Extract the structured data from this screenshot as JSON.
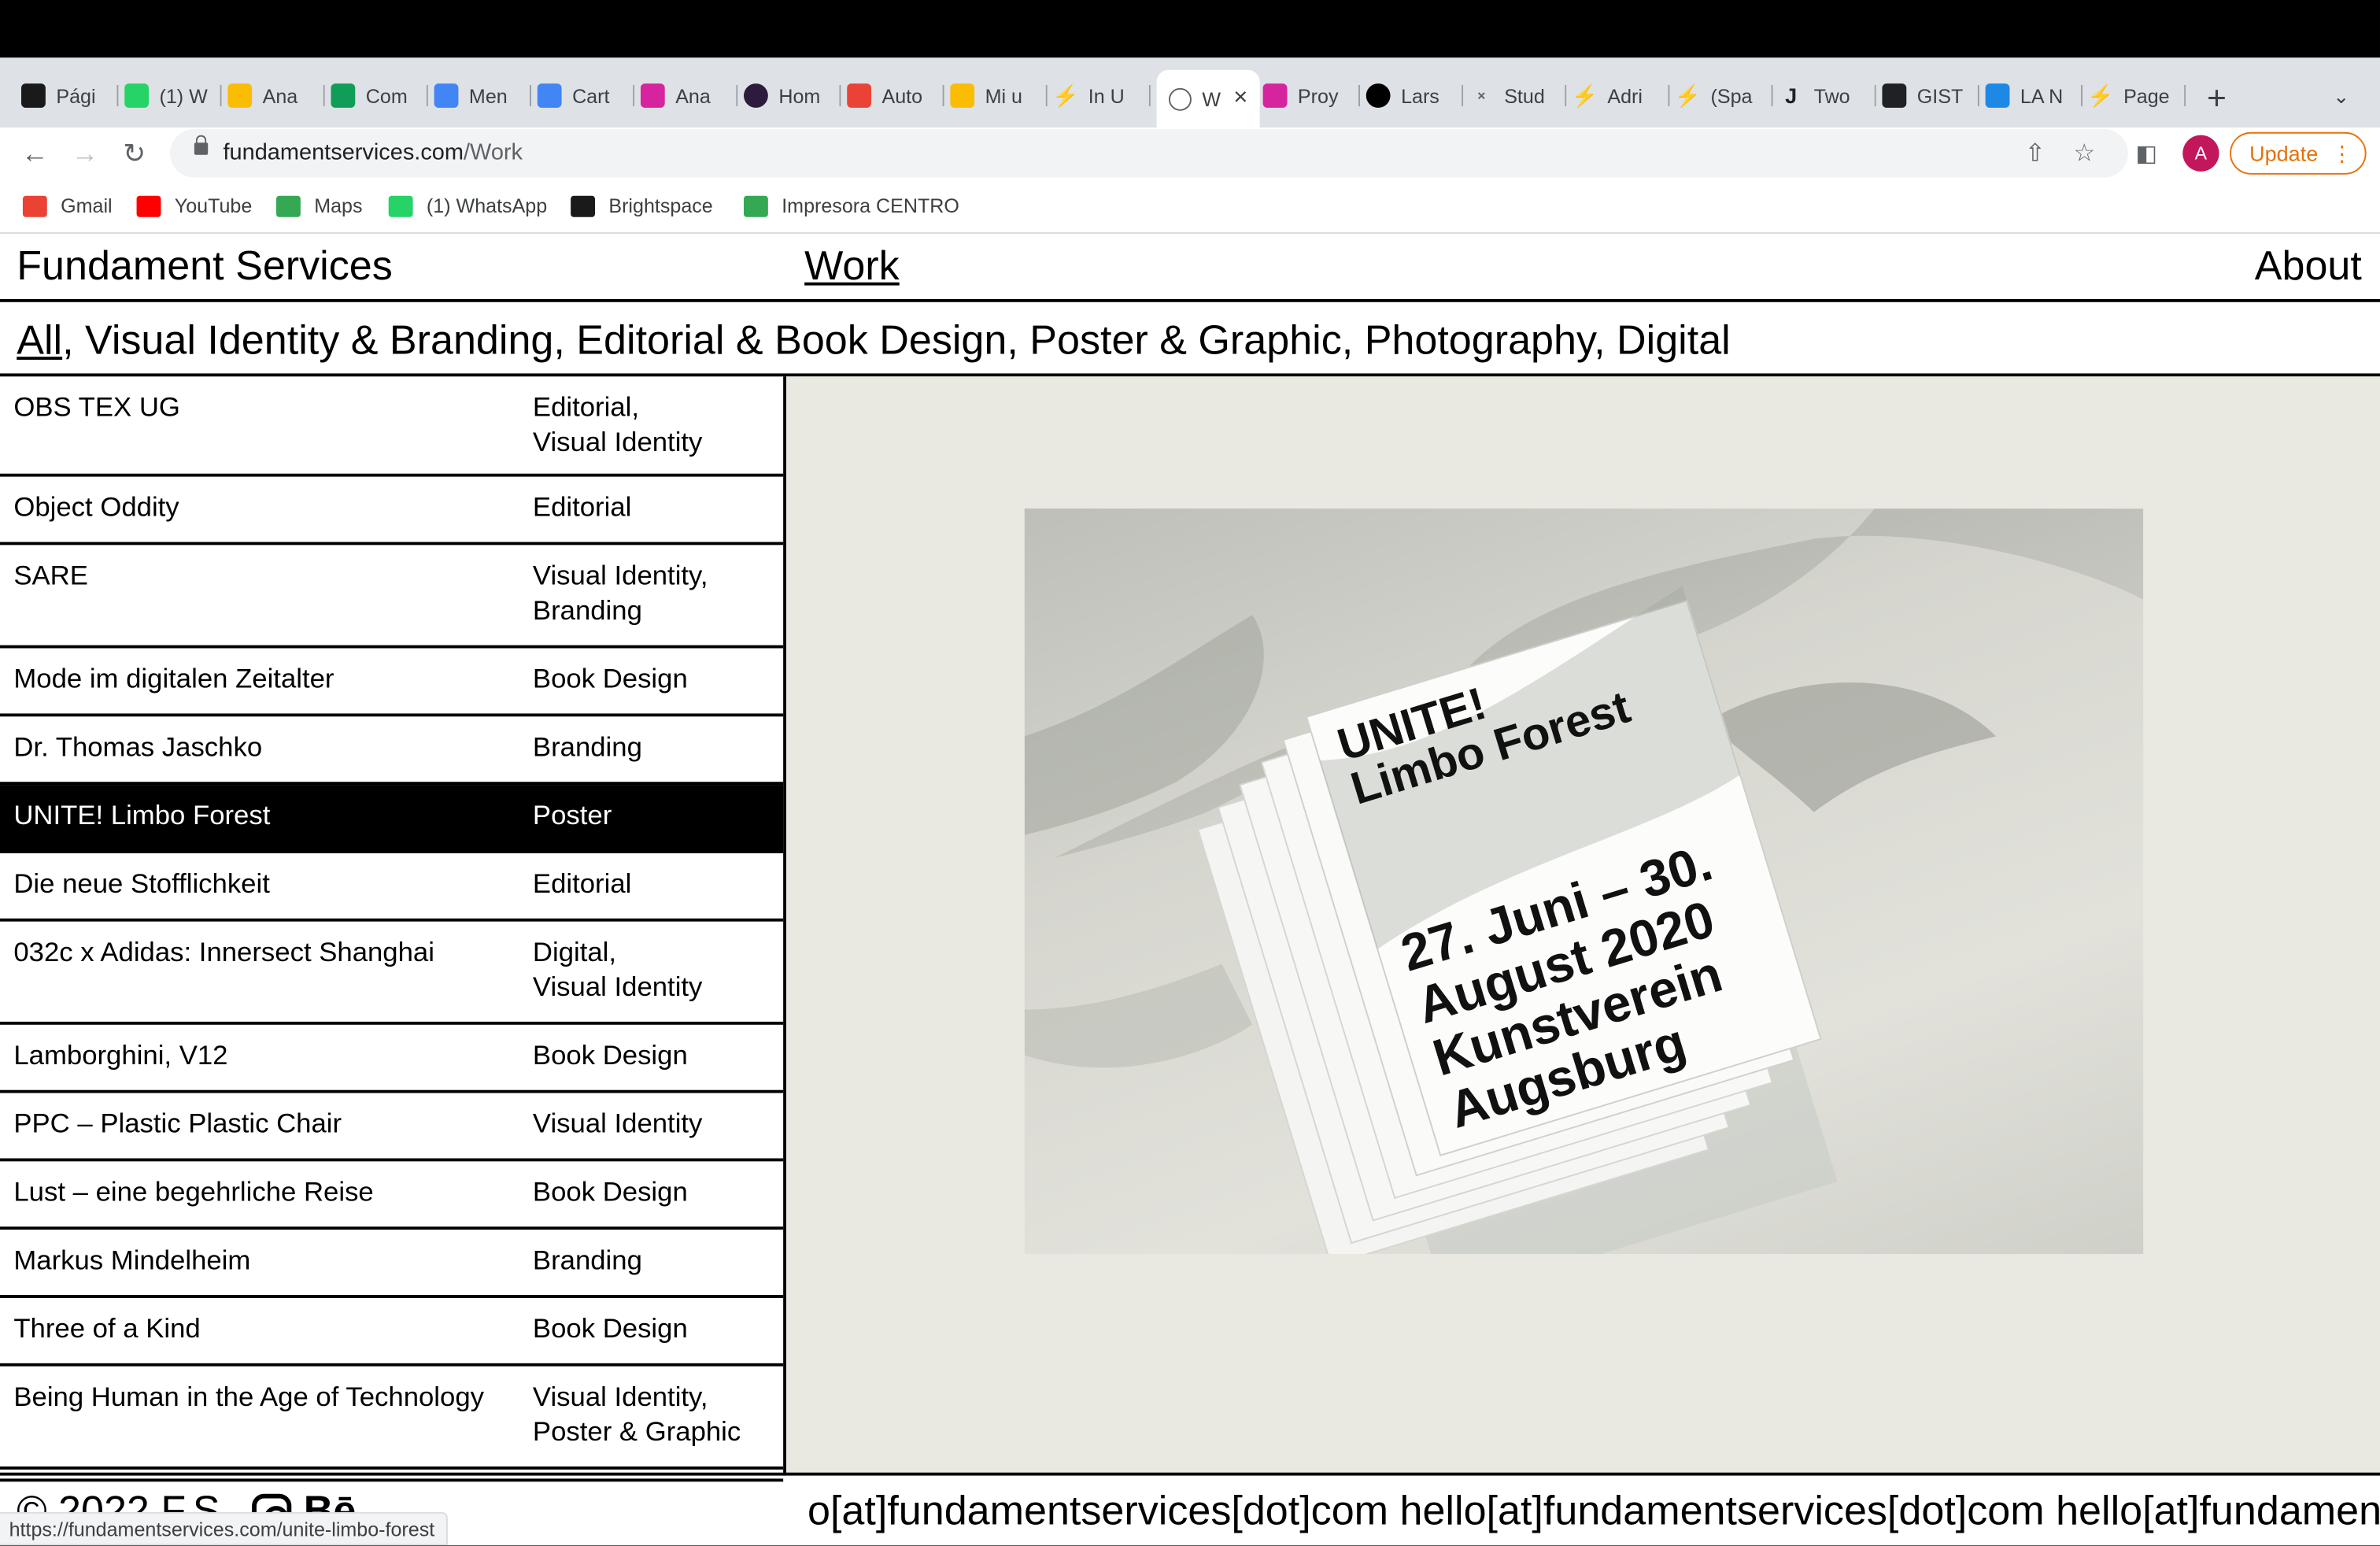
{
  "browser": {
    "tabs": [
      {
        "label": "Pági",
        "icon": "d2l-icon",
        "color": "#1a1a1a"
      },
      {
        "label": "(1) W",
        "icon": "whatsapp-icon",
        "color": "#25d366"
      },
      {
        "label": "Ana",
        "icon": "drive-icon",
        "color": "#fbbc04"
      },
      {
        "label": "Com",
        "icon": "sheets-icon",
        "color": "#0f9d58"
      },
      {
        "label": "Men",
        "icon": "docs-icon",
        "color": "#4285f4"
      },
      {
        "label": "Cart",
        "icon": "docs-icon",
        "color": "#4285f4"
      },
      {
        "label": "Ana",
        "icon": "instagram-icon",
        "color": "#d6249f"
      },
      {
        "label": "Hom",
        "icon": "circle-icon",
        "color": "#2d1b3d"
      },
      {
        "label": "Auto",
        "icon": "gmail-icon",
        "color": "#ea4335"
      },
      {
        "label": "Mi u",
        "icon": "drive-icon",
        "color": "#fbbc04"
      },
      {
        "label": "In U",
        "icon": "bolt-icon",
        "color": "#202124"
      },
      {
        "label": "W",
        "icon": "smiley-icon",
        "color": "#5f6368",
        "active": true
      },
      {
        "label": "Proy",
        "icon": "instagram-icon",
        "color": "#d6249f"
      },
      {
        "label": "Lars",
        "icon": "circle-icon",
        "color": "#000000"
      },
      {
        "label": "Stud",
        "icon": "x-icon",
        "color": "#5f6368"
      },
      {
        "label": "Adri",
        "icon": "bolt-icon",
        "color": "#202124"
      },
      {
        "label": "(Spa",
        "icon": "bolt-icon",
        "color": "#202124"
      },
      {
        "label": "Two",
        "icon": "j-icon",
        "color": "#202124"
      },
      {
        "label": "GIST",
        "icon": "gist-icon",
        "color": "#202124"
      },
      {
        "label": "LA N",
        "icon": "globe-icon",
        "color": "#1e88e5"
      },
      {
        "label": "Page",
        "icon": "bolt-icon",
        "color": "#202124"
      }
    ],
    "url_domain": "fundamentservices.com",
    "url_path": "/Work",
    "profile_initial": "A",
    "update_label": "Update",
    "bookmarks": [
      {
        "label": "Gmail",
        "icon": "gmail-icon",
        "color": "#ea4335"
      },
      {
        "label": "YouTube",
        "icon": "youtube-icon",
        "color": "#ff0000"
      },
      {
        "label": "Maps",
        "icon": "maps-icon",
        "color": "#34a853"
      },
      {
        "label": "(1) WhatsApp",
        "icon": "whatsapp-icon",
        "color": "#25d366"
      },
      {
        "label": "Brightspace",
        "icon": "d2l-icon",
        "color": "#1a1a1a"
      },
      {
        "label": "Impresora CENTRO",
        "icon": "printer-icon",
        "color": "#34a853"
      }
    ],
    "status_url": "https://fundamentservices.com/unite-limbo-forest"
  },
  "site": {
    "title": "Fundament Services",
    "nav_work": "Work",
    "nav_about": "About",
    "filter_all": "All",
    "filter_rest": ", Visual Identity & Branding, Editorial & Book Design, Poster & Graphic, Photography, Digital",
    "footer_left": "© 2022 F.S.",
    "footer_behance": "Bē",
    "footer_marquee": "o[at]fundamentservices[dot]com hello[at]fundamentservices[dot]com hello[at]fundamen"
  },
  "projects": [
    {
      "name": "OBS TEX UG",
      "cat1": "Editorial,",
      "cat2": "Visual Identity"
    },
    {
      "name": "Object Oddity",
      "cat1": "Editorial",
      "cat2": ""
    },
    {
      "name": "SARE",
      "cat1": "Visual Identity,",
      "cat2": "Branding"
    },
    {
      "name": "Mode im digitalen Zeitalter",
      "cat1": "Book Design",
      "cat2": ""
    },
    {
      "name": "Dr. Thomas Jaschko",
      "cat1": "Branding",
      "cat2": ""
    },
    {
      "name": "UNITE! Limbo Forest",
      "cat1": "Poster",
      "cat2": "",
      "selected": true
    },
    {
      "name": "Die neue Stofflichkeit",
      "cat1": "Editorial",
      "cat2": ""
    },
    {
      "name": "032c x Adidas: Innersect Shanghai",
      "cat1": "Digital,",
      "cat2": "Visual Identity"
    },
    {
      "name": "Lamborghini, V12",
      "cat1": "Book Design",
      "cat2": ""
    },
    {
      "name": "PPC – Plastic Plastic Chair",
      "cat1": "Visual Identity",
      "cat2": ""
    },
    {
      "name": "Lust – eine begehrliche Reise",
      "cat1": "Book Design",
      "cat2": ""
    },
    {
      "name": "Markus Mindelheim",
      "cat1": "Branding",
      "cat2": ""
    },
    {
      "name": "Three of a Kind",
      "cat1": "Book Design",
      "cat2": ""
    },
    {
      "name": "Being Human in the Age of Technology",
      "cat1": "Visual Identity,",
      "cat2": "Poster & Graphic"
    }
  ],
  "poster": {
    "title1": "UNITE!",
    "title2": "Limbo Forest",
    "line1": "27. Juni – 30.",
    "line2": "August 2020",
    "line3": "Kunstverein",
    "line4": "Augsburg"
  }
}
